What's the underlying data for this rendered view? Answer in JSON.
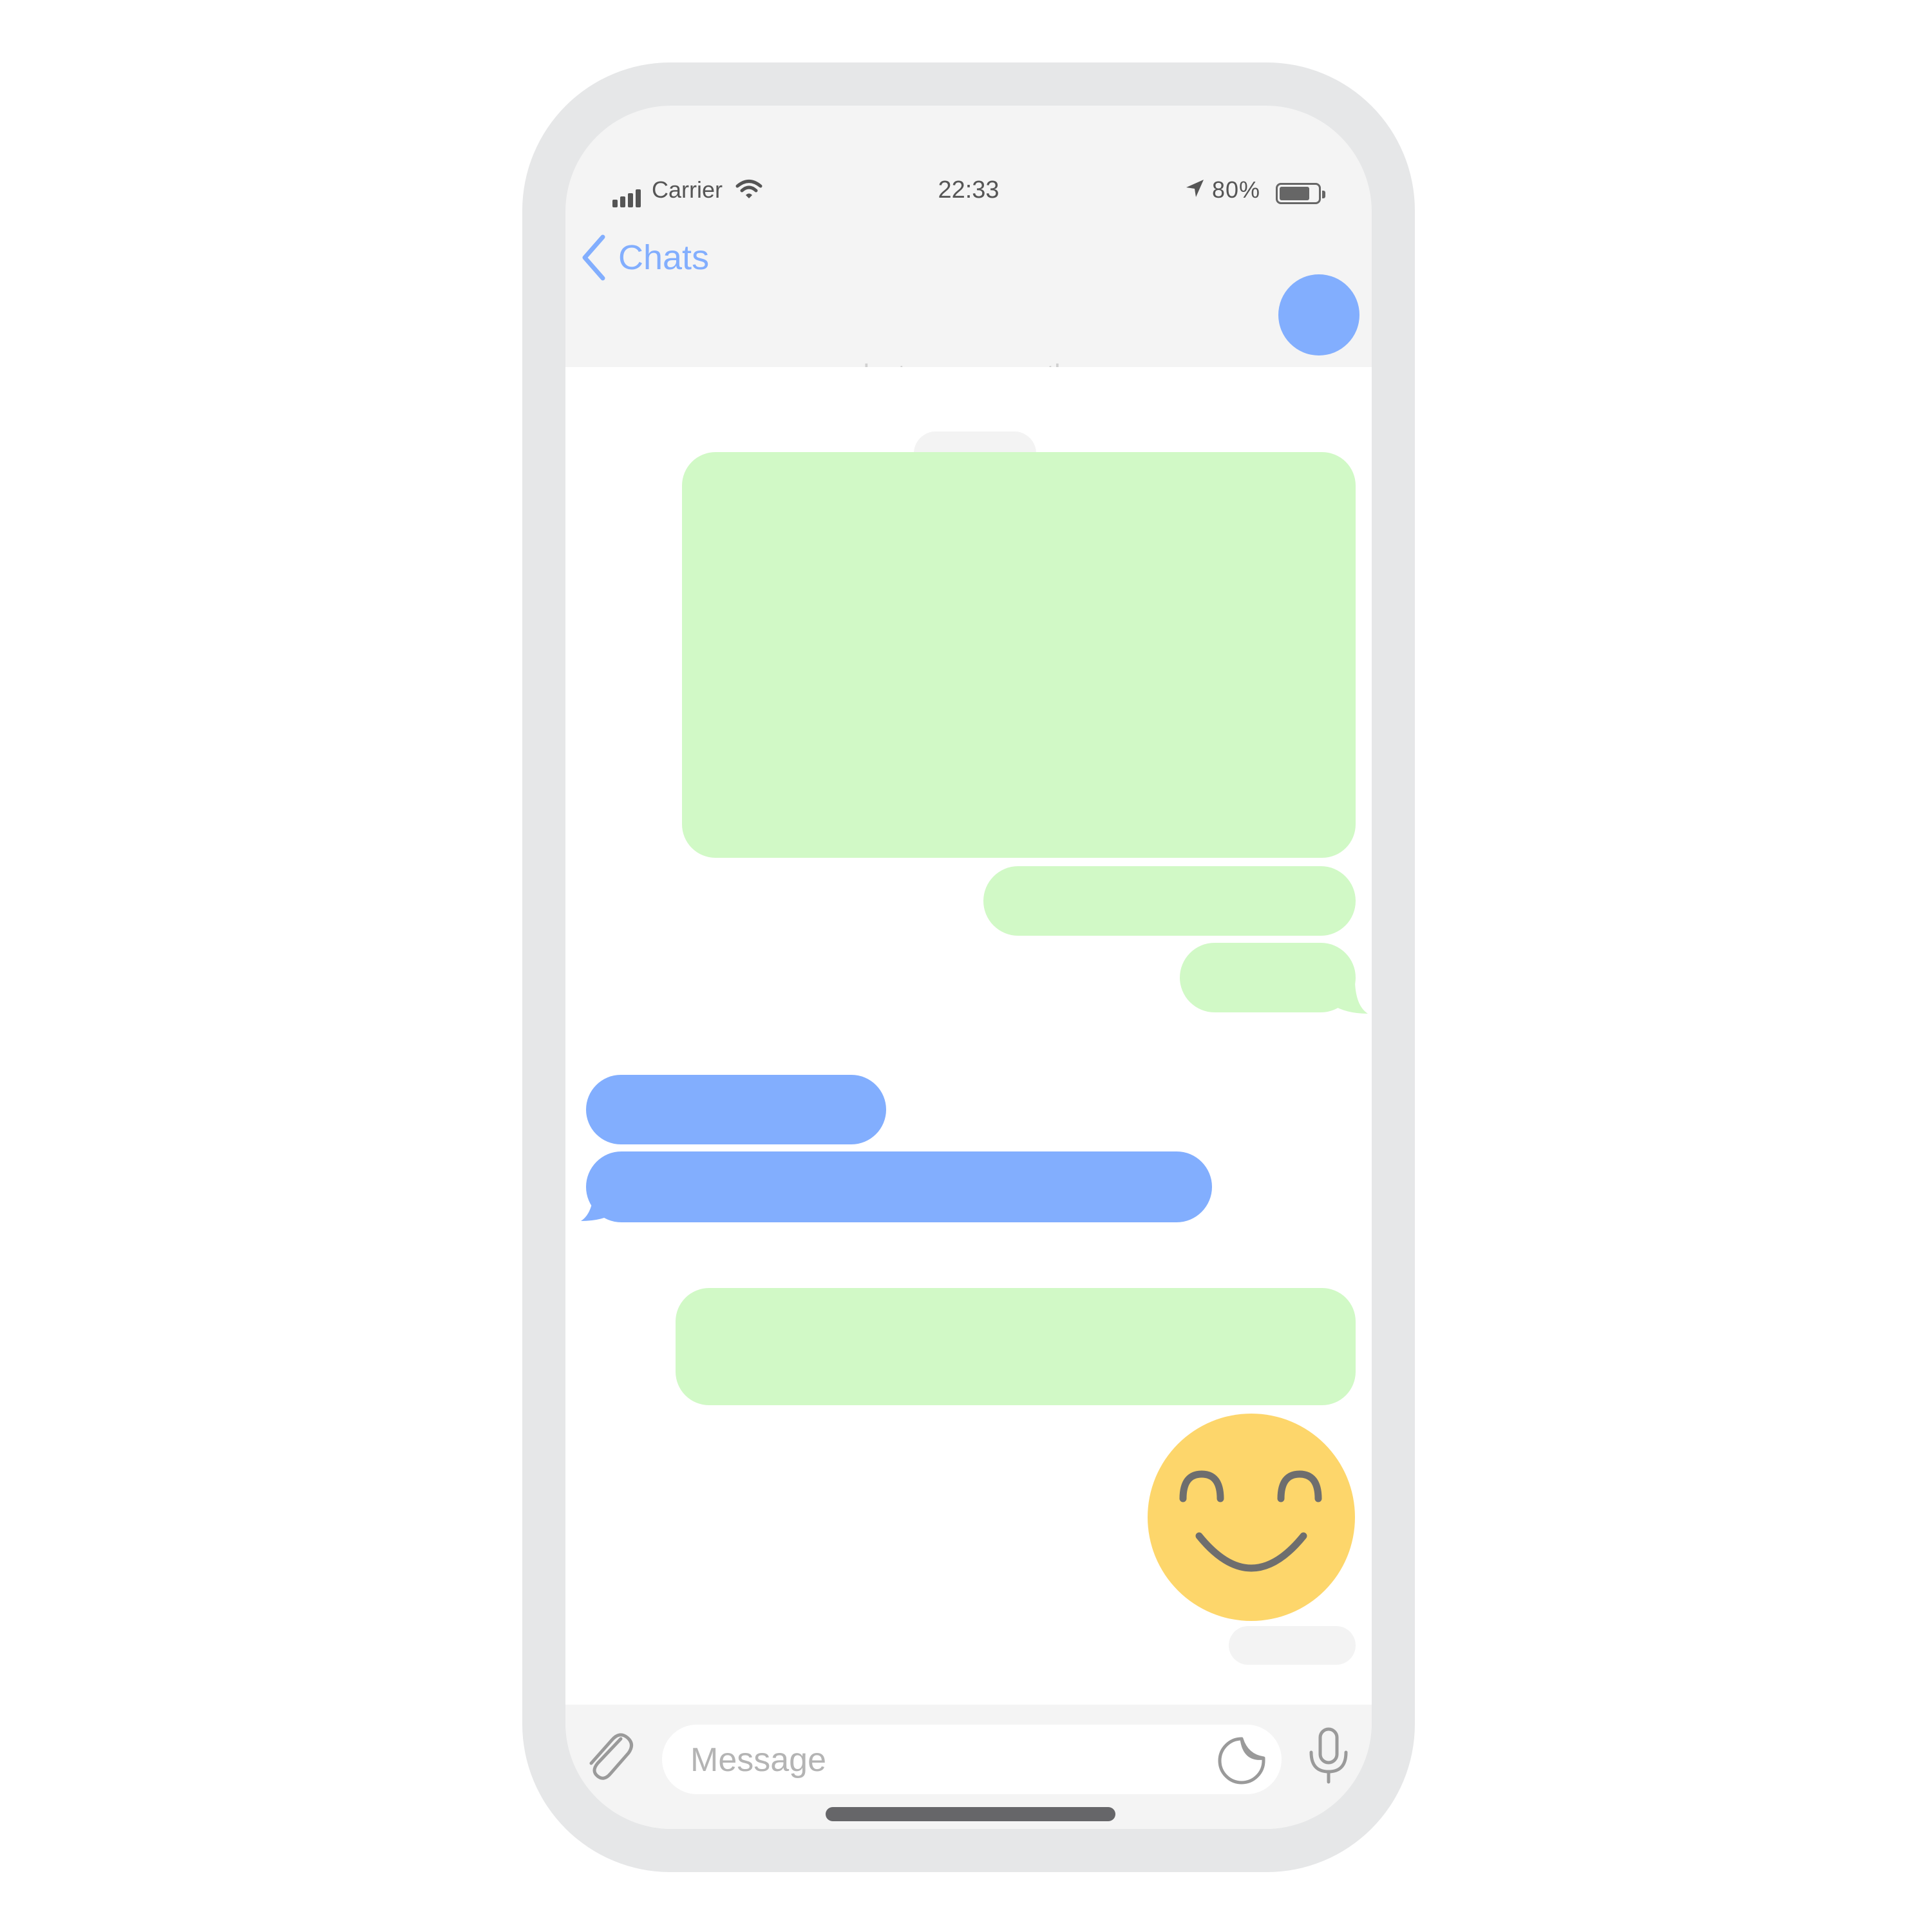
{
  "status_bar": {
    "carrier": "Carrier",
    "time": "22:33",
    "battery_percent": "80%",
    "battery_level": 0.8,
    "icons": [
      "signal-bars-icon",
      "wifi-icon",
      "location-arrow-icon",
      "battery-icon"
    ]
  },
  "nav": {
    "back_label": "Chats",
    "subtitle": "last seen recently",
    "avatar_color": "#82aefe",
    "back_icon": "chevron-left-icon"
  },
  "colors": {
    "outgoing_bubble": "#d1f9c6",
    "incoming_bubble": "#82aefe",
    "emoji_face": "#fdd66b",
    "frame": "#e6e7e8",
    "accent": "#82aefe"
  },
  "messages": [
    {
      "direction": "outgoing",
      "kind": "media"
    },
    {
      "direction": "outgoing",
      "kind": "text"
    },
    {
      "direction": "outgoing",
      "kind": "text",
      "tail": true
    },
    {
      "direction": "incoming",
      "kind": "text"
    },
    {
      "direction": "incoming",
      "kind": "text",
      "tail": true
    },
    {
      "direction": "outgoing",
      "kind": "text"
    },
    {
      "direction": "outgoing",
      "kind": "sticker",
      "icon": "smiley-emoji-icon"
    }
  ],
  "composer": {
    "placeholder": "Message",
    "icons": [
      "paperclip-icon",
      "sticker-icon",
      "microphone-icon"
    ]
  }
}
